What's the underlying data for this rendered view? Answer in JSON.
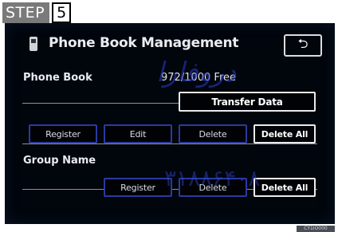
{
  "step": {
    "label": "STEP",
    "number": "5"
  },
  "screen": {
    "title": "Phone Book Management",
    "back_glyph": "⮌",
    "phone_book": {
      "label": "Phone Book",
      "count": "972/1000 Free",
      "transfer_label": "Transfer Data",
      "buttons": {
        "register": "Register",
        "edit": "Edit",
        "delete": "Delete",
        "delete_all": "Delete All"
      }
    },
    "group_name": {
      "label": "Group Name",
      "buttons": {
        "register": "Register",
        "delete": "Delete",
        "delete_all": "Delete All"
      }
    }
  },
  "watermark": {
    "arabic": "دروفارا",
    "digits": "۳۱۸۸۶۴۰۸"
  },
  "image_code": "CY1IO000",
  "icons": {
    "phone": "phone-icon",
    "back": "back-arrow-icon"
  },
  "colors": {
    "screen_bg": "#01050c",
    "button_border": "#2b3aa0",
    "step_bg": "#7a7a7a"
  }
}
